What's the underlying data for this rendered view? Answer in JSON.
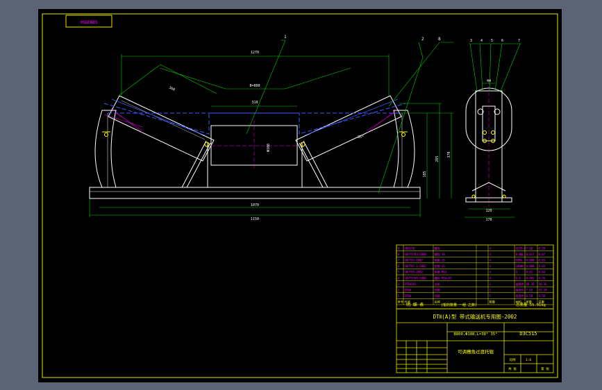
{
  "drawing": {
    "corner_code": "0SGEN85",
    "dims": {
      "total_length": "1150",
      "base_length": "1070",
      "top_span": "1270",
      "belt_width": "B=800",
      "side_roll_len": "360",
      "mid_roll_len": "310",
      "diameter": "Φ108",
      "angle": "35°",
      "height_a": "370",
      "height_b": "285",
      "height_c": "185",
      "side_w1": "44",
      "side_w2": "120",
      "side_w3": "170"
    },
    "balloons": [
      "1",
      "8",
      "2",
      "3",
      "4",
      "5",
      "6",
      "7"
    ]
  },
  "parts_table": {
    "rows": [
      {
        "no": "9",
        "code": "GB6170",
        "name": "螺母",
        "qty": "4",
        "material": "Q235-A",
        "unit": "7.18",
        "total": "0.29"
      },
      {
        "no": "8",
        "code": "GB/T5783-2000",
        "name": "螺栓 16",
        "qty": "4",
        "material": "8.8级",
        "unit": "0.017",
        "total": "0.07"
      },
      {
        "no": "7",
        "code": "GB/T93-1987",
        "name": "垫圈 16",
        "qty": "4",
        "material": "65Mn",
        "unit": "0.008",
        "total": "0.03"
      },
      {
        "no": "6",
        "code": "GB/T97.1-2002",
        "name": "垫圈 16",
        "qty": "4",
        "material": "100HV",
        "unit": "0.008",
        "total": "0.03"
      },
      {
        "no": "5",
        "code": "GB/T95-2002",
        "name": "垫圈 M16",
        "qty": "4",
        "material": "Q",
        "unit": "0.01",
        "total": "0.04"
      },
      {
        "no": "4",
        "code": "GB/T5780-2000",
        "name": "螺栓 M16×45",
        "qty": "4",
        "material": "8.8",
        "unit": "0.065",
        "total": "0.26"
      },
      {
        "no": "3",
        "code": "DT6A201",
        "name": "支架",
        "qty": "1",
        "material": "组焊件",
        "unit": "16.36",
        "total": "16.36"
      },
      {
        "no": "2",
        "code": "DT6A",
        "name": "托辊",
        "qty": "2",
        "material": "组合件",
        "unit": "7.62",
        "total": "15.24"
      },
      {
        "no": "1",
        "code": "DT6A",
        "name": "托辊",
        "qty": "1",
        "material": "组合件",
        "unit": "6.58",
        "total": "6.58"
      }
    ],
    "header": [
      "序号",
      "代号",
      "名称",
      "数量",
      "材料",
      "单重",
      "总重"
    ],
    "footer_left": "明 细 表",
    "footer_note": "(辊的数量 一组 之数)",
    "total_weight": "总质量 55.91kg"
  },
  "title_block": {
    "series_title": "DTⅡ(A)型 带式输送机专用图-2002",
    "spec": "B800,Φ108,L=38° 35°",
    "drawing_no": "D3C515",
    "drawing_name": "可调槽角过渡托辊",
    "scale_label": "比例",
    "scale_value": "1:6",
    "sheet_label": "共 张",
    "sheet_value": "第 张"
  }
}
